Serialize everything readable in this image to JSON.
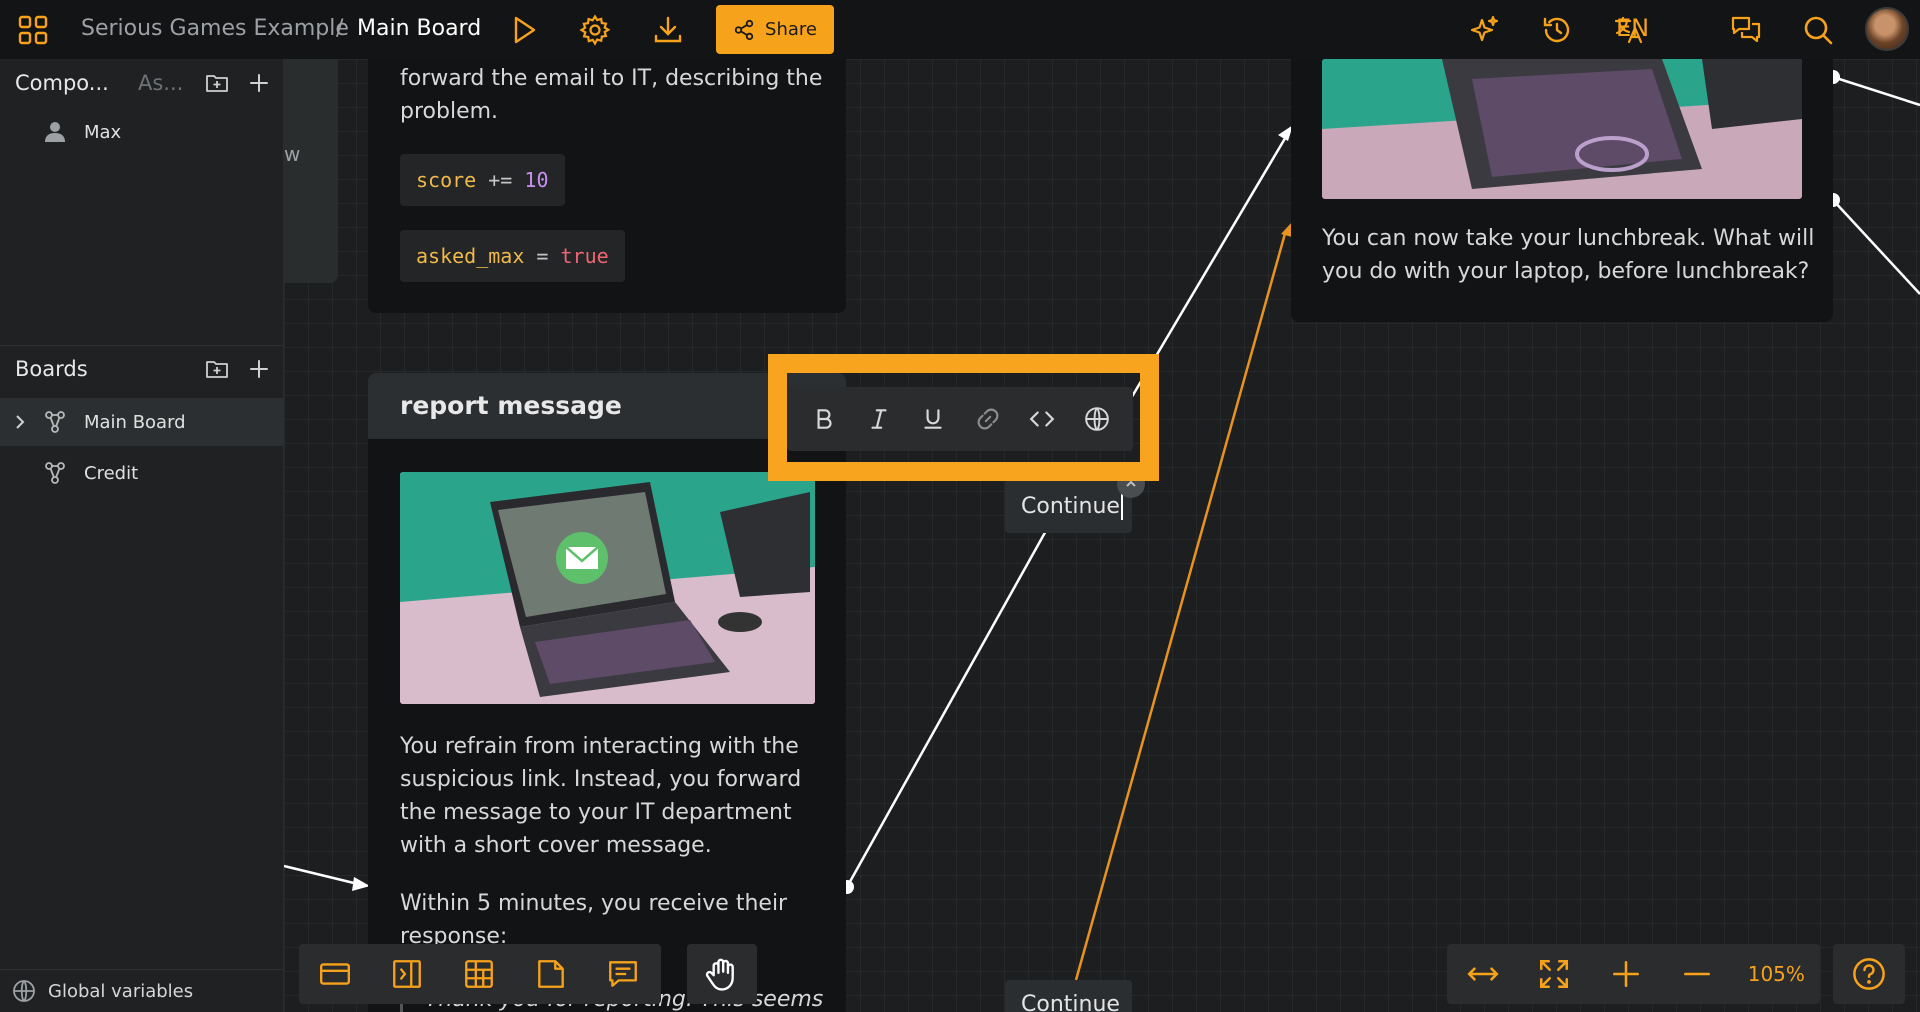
{
  "topbar": {
    "project": "Serious Games Example",
    "separator": "/",
    "board": "Main Board",
    "share_label": "Share",
    "language": "EN",
    "icons": [
      "apps-grid-icon",
      "play-icon",
      "settings-gear-icon",
      "download-icon",
      "share-icon",
      "ai-sparkle-icon",
      "history-icon",
      "translate-icon",
      "comments-icon",
      "search-icon",
      "user-avatar"
    ]
  },
  "sidebar": {
    "components_title": "Compo...",
    "assets_tab": "As...",
    "components": [
      {
        "label": "Max",
        "icon": "person-icon"
      }
    ],
    "boards_title": "Boards",
    "boards": [
      {
        "label": "Main Board",
        "icon": "board-icon",
        "active": true,
        "expandable": true
      },
      {
        "label": "Credit",
        "icon": "board-icon",
        "active": false,
        "expandable": false
      }
    ],
    "global_variables": "Global variables"
  },
  "canvas": {
    "ghost_text": "w",
    "card_top": {
      "text_lines": [
        "forward the email to IT, describing the",
        "problem."
      ],
      "code1": {
        "var": "score",
        "op": "+=",
        "val": "10"
      },
      "code2": {
        "var": "asked_max",
        "op": "=",
        "val": "true"
      }
    },
    "card_report": {
      "title": "report message",
      "para1": [
        "You refrain from interacting with the",
        "suspicious link. Instead, you forward",
        "the message to your IT department",
        "with a short cover message."
      ],
      "para2": [
        "Within 5 minutes, you receive their",
        "response:"
      ],
      "quote_partial": "Thank you for reporting. This seems to"
    },
    "card_right": {
      "text_lines": [
        "You can now take your lunchbreak. What will",
        "you do with your laptop, before lunchbreak?"
      ]
    },
    "choice_active": "Continue",
    "choice_bottom": "Continue",
    "format_toolbar": [
      "bold-icon",
      "italic-icon",
      "underline-icon",
      "link-icon",
      "code-icon",
      "globe-icon"
    ]
  },
  "bottom_toolbar": {
    "tools": [
      "dialogue-card-icon",
      "branch-icon",
      "table-icon",
      "note-icon",
      "comment-icon",
      "hand-pan-icon"
    ],
    "view": [
      "fit-width-icon",
      "fullscreen-icon",
      "zoom-in-icon",
      "zoom-out-icon"
    ],
    "zoom": "105%",
    "help": "help-icon"
  },
  "colors": {
    "accent": "#f7a21b",
    "background": "#1c1e1f",
    "card": "#121314",
    "edge": "#ffffff",
    "edge_accent": "#e8931f"
  }
}
